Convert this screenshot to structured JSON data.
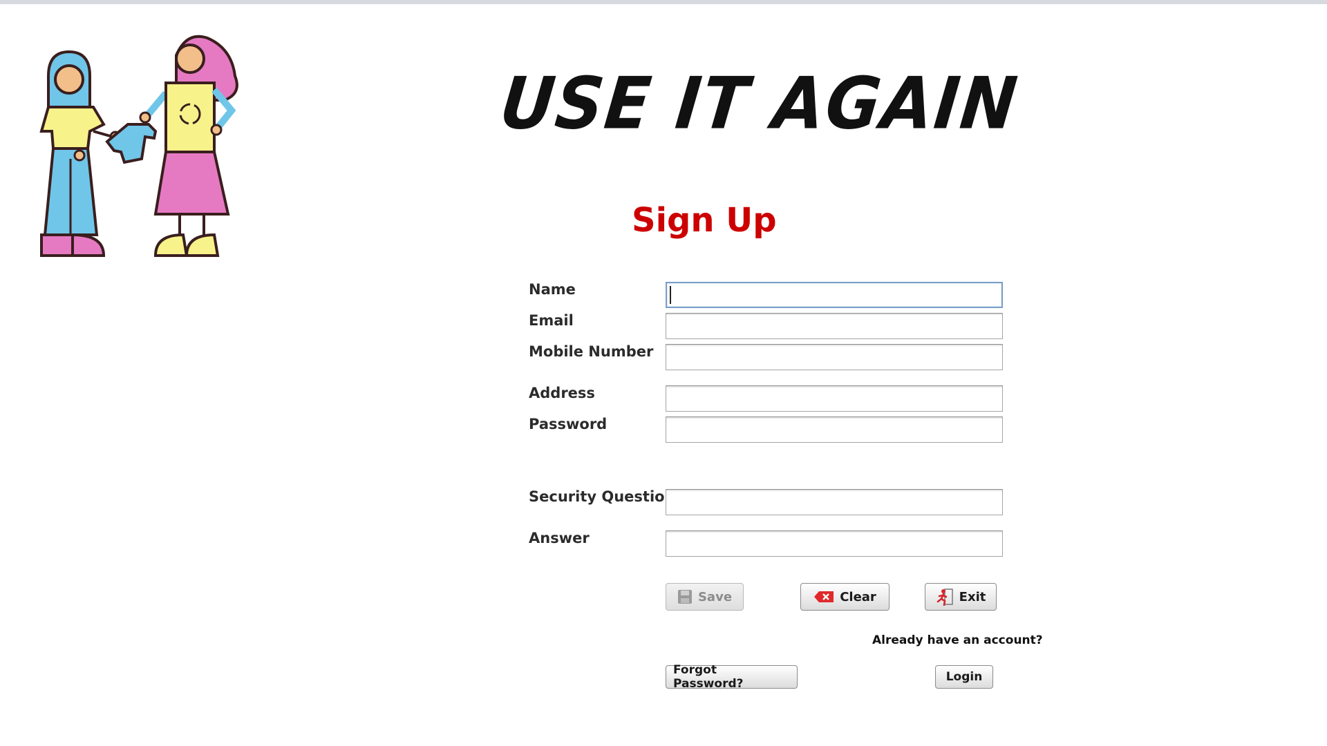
{
  "brand": {
    "title": "USE IT AGAIN"
  },
  "page": {
    "heading": "Sign Up"
  },
  "form": {
    "fields": [
      {
        "label": "Name",
        "value": ""
      },
      {
        "label": "Email",
        "value": ""
      },
      {
        "label": "Mobile Number",
        "value": ""
      },
      {
        "label": "Address",
        "value": ""
      },
      {
        "label": "Password",
        "value": ""
      },
      {
        "label": "Security Question",
        "value": ""
      },
      {
        "label": "Answer",
        "value": ""
      }
    ]
  },
  "actions": {
    "save_label": "Save",
    "clear_label": "Clear",
    "exit_label": "Exit",
    "account_prompt": "Already have an account?",
    "forgot_label": "Forgot Password?",
    "login_label": "Login"
  },
  "icons": {
    "save": "floppy-disk-icon",
    "clear": "eraser-x-icon",
    "exit": "running-exit-icon",
    "illustration": "clothes-exchange-illustration"
  },
  "colors": {
    "heading": "#cc0000",
    "focus_border": "#7b9ec9"
  }
}
